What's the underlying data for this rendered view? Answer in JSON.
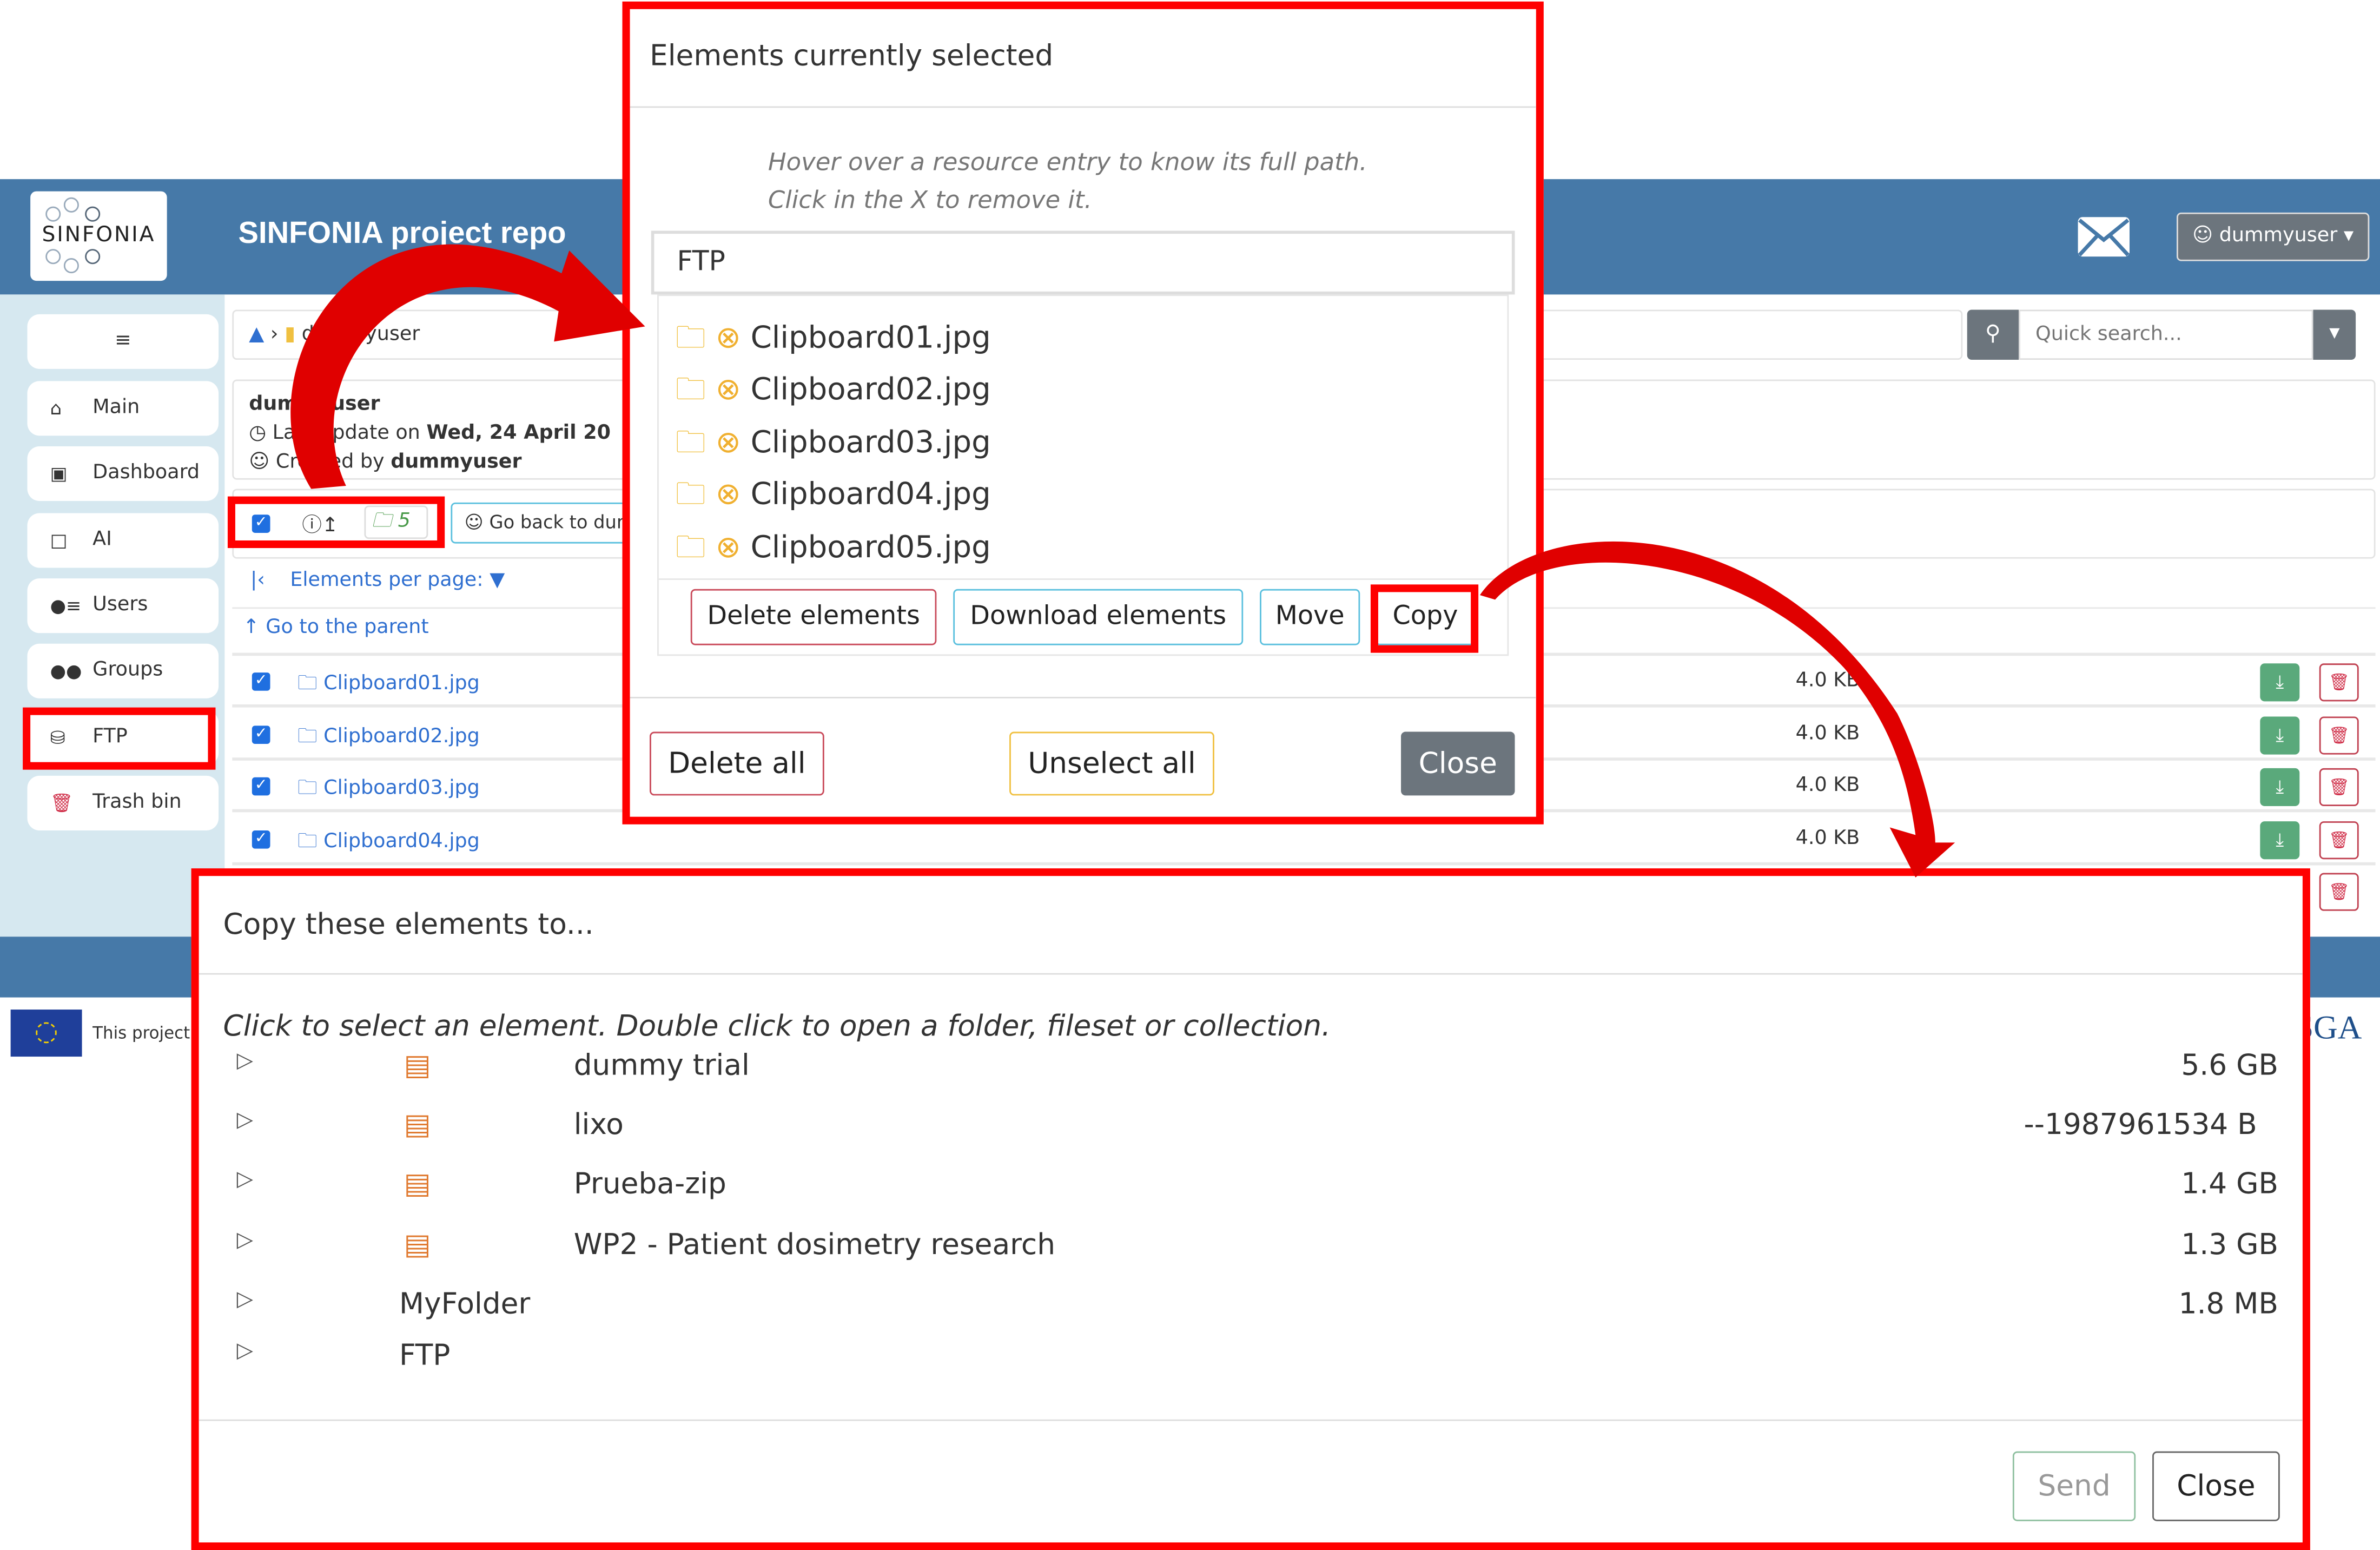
{
  "header": {
    "logo_text": "SINFONIA",
    "title": "SINFONIA project repo",
    "user_label": "dummyuser",
    "mail_icon": "envelope-icon"
  },
  "sidebar": {
    "items": [
      {
        "label": "",
        "icon": "hamburger-icon"
      },
      {
        "label": "Main",
        "icon": "home-icon"
      },
      {
        "label": "Dashboard",
        "icon": "sitemap-icon"
      },
      {
        "label": "AI",
        "icon": "file-icon"
      },
      {
        "label": "Users",
        "icon": "users-list-icon"
      },
      {
        "label": "Groups",
        "icon": "group-icon"
      },
      {
        "label": "FTP",
        "icon": "database-icon"
      },
      {
        "label": "Trash bin",
        "icon": "trash-icon"
      }
    ]
  },
  "breadcrumb": {
    "current": "dummyuser"
  },
  "search": {
    "placeholder": "Quick search..."
  },
  "info": {
    "name": "dummyuser",
    "update_prefix": "Last update on",
    "update_date": "Wed, 24 April 20",
    "created_prefix": "Created by",
    "created_by": "dummyuser"
  },
  "toolbar": {
    "selected_count": "5",
    "go_back": "Go back to dum"
  },
  "pagination": {
    "label": "Elements per page:"
  },
  "parent_link": "Go to the parent",
  "files": [
    {
      "name": "Clipboard01.jpg",
      "size": "4.0 KB"
    },
    {
      "name": "Clipboard02.jpg",
      "size": "4.0 KB"
    },
    {
      "name": "Clipboard03.jpg",
      "size": "4.0 KB"
    },
    {
      "name": "Clipboard04.jpg",
      "size": "4.0 KB"
    }
  ],
  "footer": {
    "text": "This project i",
    "partner_logo": "SGA"
  },
  "selected_modal": {
    "title": "Elements currently selected",
    "hint1": "Hover over a resource entry to know its full path.",
    "hint2": "Click in the X to remove it.",
    "group": "FTP",
    "items": [
      "Clipboard01.jpg",
      "Clipboard02.jpg",
      "Clipboard03.jpg",
      "Clipboard04.jpg",
      "Clipboard05.jpg"
    ],
    "delete_elements": "Delete elements",
    "download_elements": "Download elements",
    "move": "Move",
    "copy": "Copy",
    "delete_all": "Delete all",
    "unselect_all": "Unselect all",
    "close": "Close"
  },
  "copy_modal": {
    "title": "Copy these elements to...",
    "hint": "Click to select an element. Double click to open a folder, fileset or collection.",
    "entries": [
      {
        "name": "dummy trial",
        "size": "5.6 GB",
        "icon": "archive-icon"
      },
      {
        "name": "lixo",
        "size": "--1987961534 B",
        "icon": "archive-icon"
      },
      {
        "name": "Prueba-zip",
        "size": "1.4 GB",
        "icon": "archive-icon"
      },
      {
        "name": "WP2 - Patient dosimetry research",
        "size": "1.3 GB",
        "icon": "archive-icon"
      },
      {
        "name": "MyFolder",
        "size": "1.8 MB"
      },
      {
        "name": "FTP",
        "size": ""
      }
    ],
    "send": "Send",
    "close": "Close"
  },
  "colors": {
    "header": "#4679a8",
    "sidebar": "#d6e8f0",
    "annotation": "#ff0000",
    "link": "#2f6fd0"
  }
}
